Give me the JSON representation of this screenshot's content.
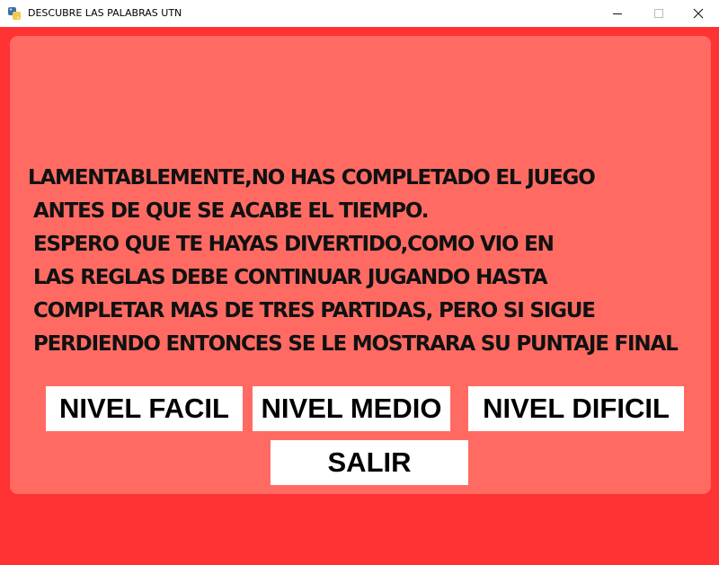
{
  "window": {
    "title": "DESCUBRE LAS PALABRAS UTN"
  },
  "message": {
    "lines": [
      "LAMENTABLEMENTE,NO HAS COMPLETADO EL JUEGO",
      "ANTES DE QUE SE ACABE EL TIEMPO.",
      "ESPERO QUE TE HAYAS DIVERTIDO,COMO VIO EN",
      "LAS REGLAS DEBE CONTINUAR JUGANDO HASTA",
      "COMPLETAR MAS DE TRES PARTIDAS, PERO SI SIGUE",
      "PERDIENDO ENTONCES SE LE MOSTRARA SU PUNTAJE FINAL"
    ]
  },
  "buttons": {
    "easy": "NIVEL FACIL",
    "medium": "NIVEL MEDIO",
    "hard": "NIVEL DIFICIL",
    "exit": "SALIR"
  },
  "colors": {
    "background": "#ff3333",
    "panel": "#ff6b62",
    "button": "#ffffff"
  }
}
